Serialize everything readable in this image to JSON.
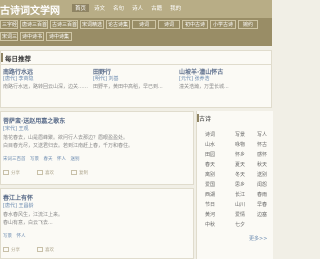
{
  "site": {
    "logo": "古诗词文学网"
  },
  "nav": [
    "首页",
    "诗文",
    "名句",
    "诗人",
    "古籍",
    "我的"
  ],
  "categories": [
    "三字经",
    "唐诗三百首",
    "古诗三百首",
    "宋词精选",
    "论古诗集",
    "诗词",
    "诗词",
    "初中古诗",
    "小学古诗",
    "婉约",
    "宋词三百",
    "诗中诗书",
    "诗中诗集"
  ],
  "hot": {
    "title": "每日推荐",
    "items": [
      {
        "title": "南路行水远",
        "meta": "[唐代] 李商隐",
        "body": "南路行水远，路转回云山深，边关……"
      },
      {
        "title": "田野行",
        "meta": "[明代] 刘基",
        "body": "田野平，黄田中高稻，早已到..."
      },
      {
        "title": "山坡羊·潼山怀古",
        "meta": "[元代] 张养浩",
        "body": "潼关浩瀚，万里长城..."
      }
    ]
  },
  "poem1": {
    "title": "菩萨蛮·送赵用嘉之歌东",
    "meta": "[宋代] 王观",
    "lines": [
      "落花春去，山是眉峰聚。欲问行人去那边？眉眼盈盈处。",
      "白目春光尽，又送君归去。若到江南赶上春，千万和春住。"
    ],
    "tags": "宋词三百首　写景　春天　怀人　送别"
  },
  "poem2": {
    "title": "春江上有怀",
    "meta": "[唐代] 王昌龄",
    "lines": [
      "春水春风生，江流江上来。",
      "春山有意，白云飞去..."
    ],
    "tags": "写景　怀人"
  },
  "sidebar": {
    "title": "古诗",
    "words": [
      "诗词",
      "写景",
      "写人",
      "山水",
      "咏物",
      "怀古",
      "田园",
      "怀乡",
      "感怀",
      "春天",
      "夏天",
      "秋天",
      "离别",
      "冬天",
      "送别",
      "爱国",
      "思乡",
      "闺怨",
      "西湖",
      "长江",
      "春雨",
      "节日",
      "山川",
      "早春",
      "黄河",
      "爱情",
      "边塞",
      "中秋",
      "七夕",
      "更多>>"
    ]
  },
  "actions": {
    "share": "分享",
    "like": "喜欢",
    "copy": "复制",
    "more": "+"
  }
}
